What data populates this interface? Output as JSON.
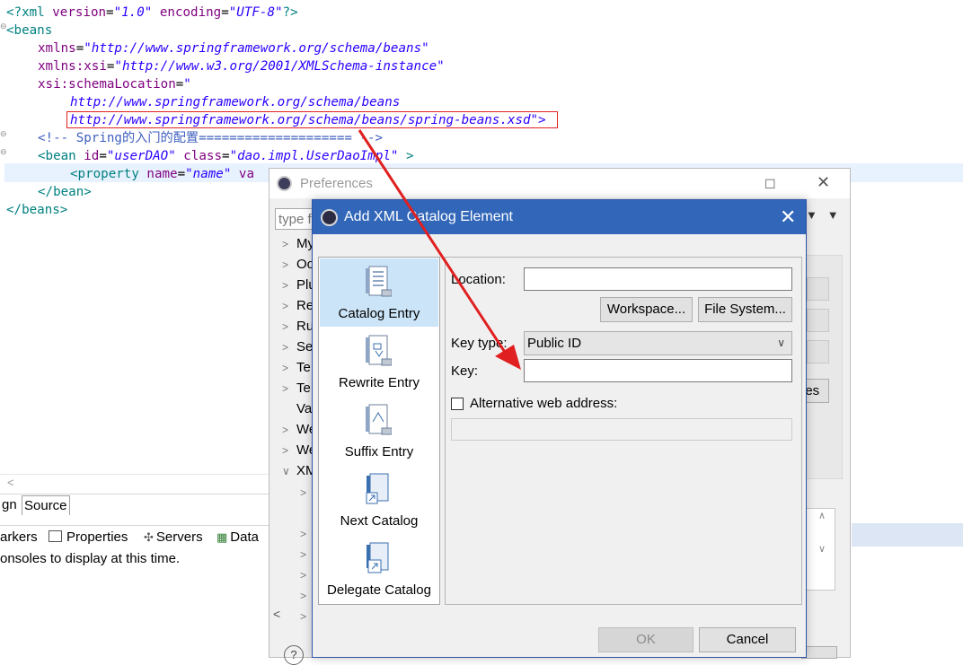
{
  "editor": {
    "lines": {
      "l1": {
        "a": "<?xml ",
        "b": "version",
        "c": "=",
        "d": "\"1.0\"",
        "e": " ",
        "f": "encoding",
        "g": "=",
        "h": "\"UTF-8\"",
        "i": "?>"
      },
      "l2": "<beans",
      "l3": {
        "attr": "xmlns",
        "eq": "=",
        "val": "\"http://www.springframework.org/schema/beans\""
      },
      "l4": {
        "attr": "xmlns:xsi",
        "eq": "=",
        "val": "\"http://www.w3.org/2001/XMLSchema-instance\""
      },
      "l5": {
        "attr": "xsi:schemaLocation",
        "eq": "=",
        "val": "\""
      },
      "l6": "http://www.springframework.org/schema/beans",
      "l7": {
        "val": "http://www.springframework.org/schema/beans/spring-beans.xsd",
        "tail": "\">"
      },
      "l8": "<!-- Spring的入门的配置==================== -->",
      "l9": {
        "tag": "<bean ",
        "a1": "id",
        "v1": "\"userDAO\"",
        "a2": " class",
        "v2": "\"dao.impl.UserDaoImpl\"",
        "end": " >"
      },
      "l10": {
        "tag": "<property ",
        "a1": "name",
        "v1": "\"name\"",
        "a2": " va"
      },
      "l11": "</bean>",
      "l12": "</beans>"
    },
    "tabs": {
      "design": "gn",
      "source": "Source"
    },
    "views": {
      "markers": "arkers",
      "properties": "Properties",
      "servers": "Servers",
      "data": "Data"
    },
    "console_message": "onsoles to display at this time."
  },
  "preferences": {
    "title": "Preferences",
    "filter_placeholder": "type f",
    "tree": [
      "My",
      "Oo",
      "Plu",
      "Re",
      "Ru",
      "Se",
      "Te",
      "Te",
      "Va",
      "We",
      "We",
      "XM"
    ],
    "partial_button": "ies"
  },
  "dialog": {
    "title": "Add XML Catalog Element",
    "entries": [
      "Catalog Entry",
      "Rewrite Entry",
      "Suffix Entry",
      "Next Catalog",
      "Delegate Catalog"
    ],
    "location_label": "Location:",
    "location_value": "",
    "workspace_button": "Workspace...",
    "filesystem_button": "File System...",
    "keytype_label": "Key type:",
    "keytype_value": "Public ID",
    "key_label": "Key:",
    "key_value": "",
    "alt_label": "Alternative web address:",
    "alt_value": "",
    "ok_label": "OK",
    "cancel_label": "Cancel"
  },
  "colors": {
    "annotation": "#e02020",
    "title_bar": "#3166b8",
    "selection": "#cce4f7"
  }
}
